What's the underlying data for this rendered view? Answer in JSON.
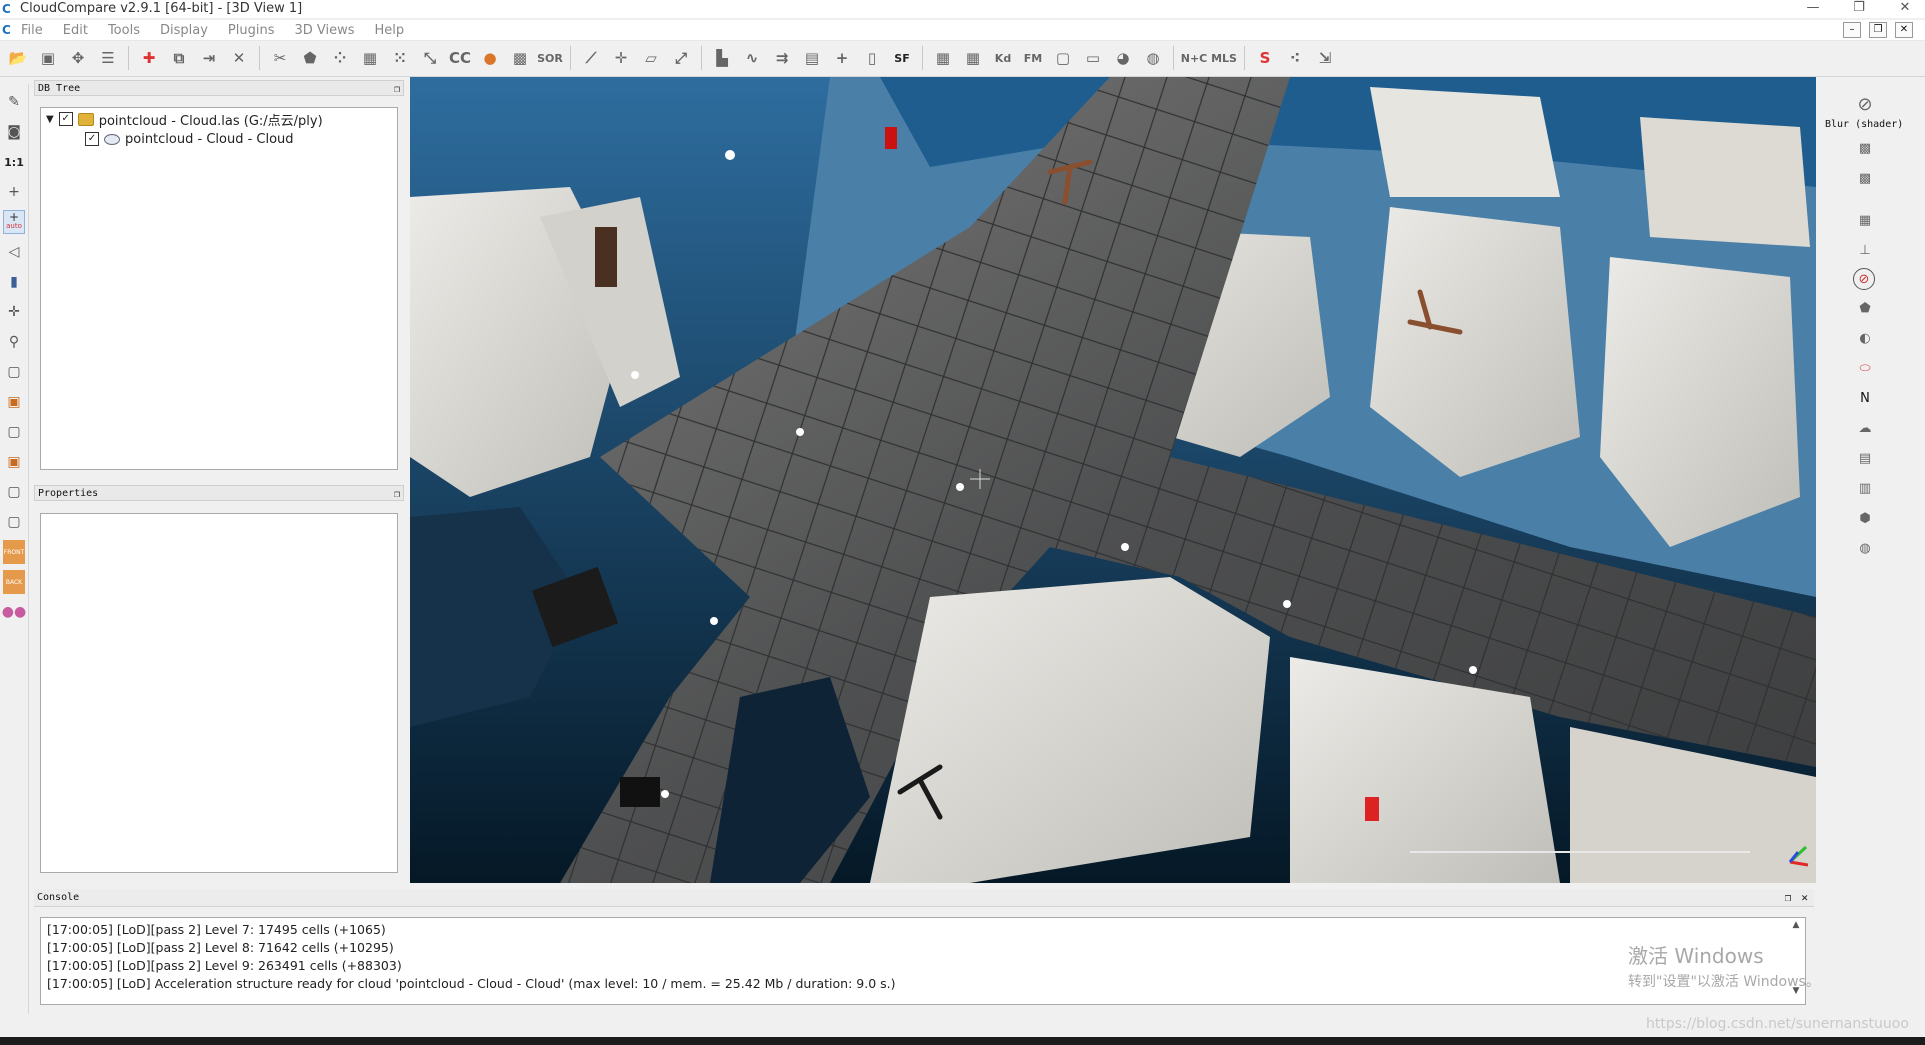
{
  "window": {
    "title": "CloudCompare v2.9.1 [64-bit] - [3D View 1]",
    "app_icon": "C",
    "minimize": "—",
    "restore": "❐",
    "close": "✕"
  },
  "menu": {
    "items": [
      "File",
      "Edit",
      "Tools",
      "Display",
      "Plugins",
      "3D Views",
      "Help"
    ]
  },
  "toolbar": {
    "icons": [
      "open-icon",
      "save-icon",
      "connect-icon",
      "list-icon",
      "sep",
      "point-picking-icon",
      "clone-icon",
      "merge-icon",
      "delete-icon",
      "sep",
      "segment-icon",
      "shield-icon",
      "sample-icon",
      "filter-icon",
      "noise-icon",
      "subsample-icon",
      "cc-icon",
      "color-icon",
      "checker-icon",
      "sor-icon",
      "sep",
      "measure-icon",
      "move-icon",
      "plane-icon",
      "stretch-icon",
      "sep",
      "histogram-icon",
      "curve-icon",
      "align-icon",
      "stats-icon",
      "crosshair-icon",
      "doc-icon",
      "sf-icon",
      "sep",
      "canupo-icon",
      "classify-icon",
      "kd-icon",
      "fm-icon",
      "box-icon",
      "sq-icon",
      "sphere-icon",
      "globe-icon",
      "sep",
      "n-c-icon",
      "mls-icon",
      "sep",
      "s-icon",
      "dots-icon",
      "export-icon"
    ],
    "labels": {
      "sor": "SOR",
      "sf": "SF",
      "kd": "Kd",
      "fm": "FM",
      "nc": "N+C",
      "mls": "MLS"
    }
  },
  "leftbar": {
    "labels": {
      "one_to_one": "1:1",
      "auto": "auto",
      "front": "FRONT",
      "back": "BACK"
    }
  },
  "db_tree": {
    "title": "DB Tree",
    "root_label": "pointcloud - Cloud.las (G:/点云/ply)",
    "child_label": "pointcloud - Cloud - Cloud"
  },
  "properties": {
    "title": "Properties"
  },
  "right_panel": {
    "blur_label": "Blur (shader)",
    "north_label": "N"
  },
  "console": {
    "title": "Console",
    "lines": [
      "[17:00:05] [LoD][pass 2] Level 7: 17495 cells (+1065)",
      "[17:00:05] [LoD][pass 2] Level 8: 71642 cells (+10295)",
      "[17:00:05] [LoD][pass 2] Level 9: 263491 cells (+88303)",
      "[17:00:05] [LoD] Acceleration structure ready for cloud 'pointcloud - Cloud - Cloud' (max level: 10 / mem. = 25.42 Mb / duration: 9.0 s.)"
    ]
  },
  "watermark": {
    "line1": "激活 Windows",
    "line2": "转到\"设置\"以激活 Windows。",
    "csdn": "https://blog.csdn.net/sunernanstuuoo"
  }
}
